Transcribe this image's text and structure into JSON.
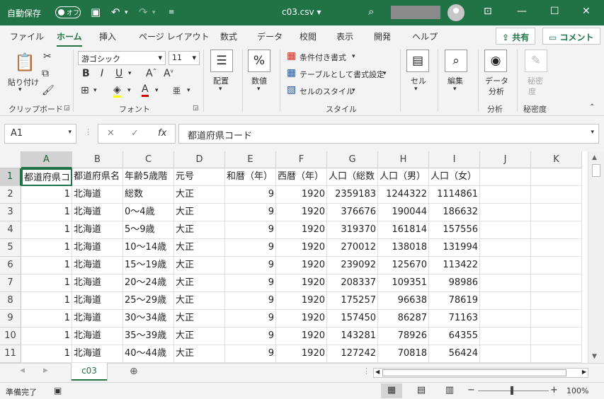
{
  "titlebar": {
    "autosave_label": "自動保存",
    "autosave_state": "オフ",
    "filename": "c03.csv ▾",
    "colors": {
      "bg": "#217346"
    }
  },
  "ribbon_tabs": [
    "ファイル",
    "ホーム",
    "挿入",
    "ページ レイアウト",
    "数式",
    "データ",
    "校閲",
    "表示",
    "開発",
    "ヘルプ"
  ],
  "active_tab": "ホーム",
  "share": {
    "share_label": "共有",
    "comment_label": "コメント"
  },
  "ribbon": {
    "paste_label": "貼り付け",
    "clipboard_label": "クリップボード",
    "font_name": "游ゴシック",
    "font_size": "11",
    "font_label": "フォント",
    "align_label": "配置",
    "number_label": "数値",
    "cond_format": "条件付き書式",
    "table_format": "テーブルとして書式設定",
    "cell_style": "セルのスタイル",
    "style_label": "スタイル",
    "cells_label": "セル",
    "edit_label": "編集",
    "data_analysis_l1": "データ",
    "data_analysis_l2": "分析",
    "analysis_label": "分析",
    "sensitivity_l1": "秘密",
    "sensitivity_l2": "度",
    "sensitivity_label": "秘密度"
  },
  "formula_bar": {
    "name_box": "A1",
    "formula": "都道府県コード"
  },
  "columns": [
    "A",
    "B",
    "C",
    "D",
    "E",
    "F",
    "G",
    "H",
    "I",
    "J",
    "K"
  ],
  "rows": [
    [
      "1",
      "都道府県コ",
      "都道府県名",
      "年齢5歳階",
      "元号",
      "和暦（年）",
      "西暦（年）",
      "人口（総数",
      "人口（男）",
      "人口（女）",
      "",
      ""
    ],
    [
      "2",
      "1",
      "北海道",
      "総数",
      "大正",
      "9",
      "1920",
      "2359183",
      "1244322",
      "1114861",
      "",
      ""
    ],
    [
      "3",
      "1",
      "北海道",
      "0～4歳",
      "大正",
      "9",
      "1920",
      "376676",
      "190044",
      "186632",
      "",
      ""
    ],
    [
      "4",
      "1",
      "北海道",
      "5～9歳",
      "大正",
      "9",
      "1920",
      "319370",
      "161814",
      "157556",
      "",
      ""
    ],
    [
      "5",
      "1",
      "北海道",
      "10～14歳",
      "大正",
      "9",
      "1920",
      "270012",
      "138018",
      "131994",
      "",
      ""
    ],
    [
      "6",
      "1",
      "北海道",
      "15～19歳",
      "大正",
      "9",
      "1920",
      "239092",
      "125670",
      "113422",
      "",
      ""
    ],
    [
      "7",
      "1",
      "北海道",
      "20～24歳",
      "大正",
      "9",
      "1920",
      "208337",
      "109351",
      "98986",
      "",
      ""
    ],
    [
      "8",
      "1",
      "北海道",
      "25～29歳",
      "大正",
      "9",
      "1920",
      "175257",
      "96638",
      "78619",
      "",
      ""
    ],
    [
      "9",
      "1",
      "北海道",
      "30～34歳",
      "大正",
      "9",
      "1920",
      "157450",
      "86287",
      "71163",
      "",
      ""
    ],
    [
      "10",
      "1",
      "北海道",
      "35～39歳",
      "大正",
      "9",
      "1920",
      "143281",
      "78926",
      "64355",
      "",
      ""
    ],
    [
      "11",
      "1",
      "北海道",
      "40～44歳",
      "大正",
      "9",
      "1920",
      "127242",
      "70818",
      "56424",
      "",
      ""
    ]
  ],
  "sheet_tab": "c03",
  "status": {
    "ready": "準備完了",
    "zoom": "100%"
  }
}
